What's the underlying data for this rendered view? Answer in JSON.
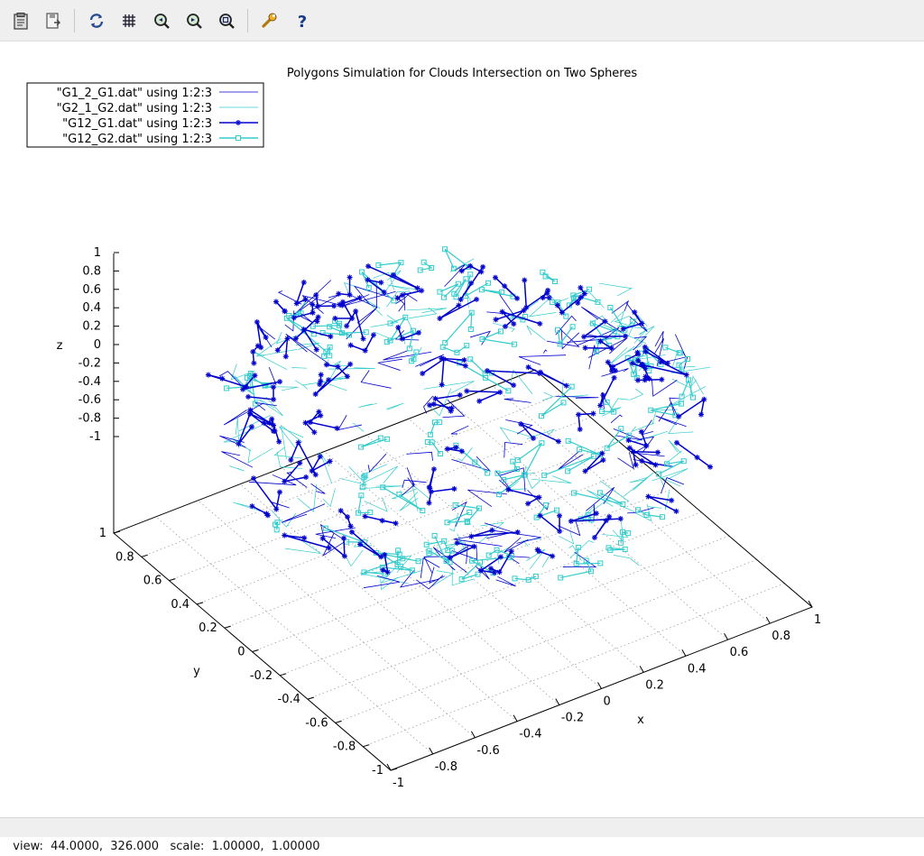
{
  "toolbar": {
    "buttons": [
      {
        "name": "copy-to-clipboard-button",
        "icon": "clipboard-icon"
      },
      {
        "name": "export-button",
        "icon": "export-icon"
      },
      {
        "name": "replot-button",
        "icon": "replot-icon"
      },
      {
        "name": "grid-button",
        "icon": "grid-icon"
      },
      {
        "name": "zoom-previous-button",
        "icon": "zoom-previous-icon"
      },
      {
        "name": "zoom-next-button",
        "icon": "zoom-next-icon"
      },
      {
        "name": "zoom-autoscale-button",
        "icon": "zoom-autoscale-icon"
      },
      {
        "name": "settings-button",
        "icon": "wrench-icon"
      },
      {
        "name": "help-button",
        "icon": "help-icon"
      }
    ]
  },
  "colors": {
    "blue": "#0000cc",
    "cyan": "#33cccc",
    "axis": "#000000",
    "grid": "#a0a0a0"
  },
  "chart_data": {
    "type": "scatter",
    "title": "Polygons Simulation for Clouds Intersection on Two Spheres",
    "xlabel": "x",
    "ylabel": "y",
    "zlabel": "z",
    "xlim": [
      -1,
      1
    ],
    "ylim": [
      -1,
      1
    ],
    "zlim": [
      -1,
      1
    ],
    "x_ticks": [
      "-1",
      "-0.8",
      "-0.6",
      "-0.4",
      "-0.2",
      "0",
      "0.2",
      "0.4",
      "0.6",
      "0.8",
      "1"
    ],
    "y_ticks": [
      "-1",
      "-0.8",
      "-0.6",
      "-0.4",
      "-0.2",
      "0",
      "0.2",
      "0.4",
      "0.6",
      "0.8",
      "1"
    ],
    "z_ticks": [
      "1",
      "0.8",
      "0.6",
      "0.4",
      "0.2",
      "0",
      "-0.2",
      "-0.4",
      "-0.6",
      "-0.8",
      "-1"
    ],
    "grid": true,
    "legend_position": "top-left",
    "series": [
      {
        "name": "\"G1_2_G1.dat\"  using 1:2:3",
        "style": "lines",
        "color": "#0000cc"
      },
      {
        "name": "\"G2_1_G2.dat\"  using 1:2:3",
        "style": "lines",
        "color": "#33cccc"
      },
      {
        "name": "\"G12_G1.dat\"  using 1:2:3",
        "style": "linespoints-star",
        "color": "#0000cc"
      },
      {
        "name": "\"G12_G2.dat\"  using 1:2:3",
        "style": "linespoints-square",
        "color": "#33cccc"
      }
    ]
  },
  "status": {
    "text": "view:  44.0000,  326.000   scale:  1.00000,  1.00000"
  }
}
